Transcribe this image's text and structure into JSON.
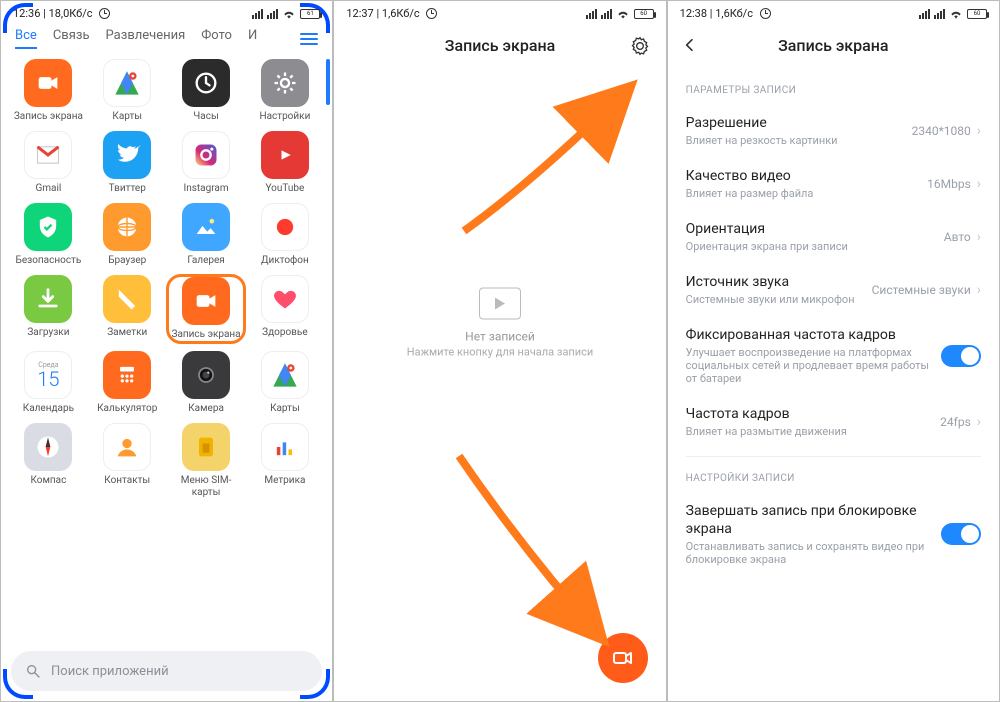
{
  "phone1": {
    "status": {
      "time": "12:36",
      "net": "18,0Кб/с",
      "battery": "61"
    },
    "tabs": [
      "Все",
      "Связь",
      "Развлечения",
      "Фото",
      "И"
    ],
    "apps": [
      {
        "label": "Запись экрана",
        "bg": "#ff6a1f",
        "glyph": "cam"
      },
      {
        "label": "Карты",
        "bg": "#ffffff",
        "glyph": "gmaps"
      },
      {
        "label": "Часы",
        "bg": "#2b2b2b",
        "glyph": "clock"
      },
      {
        "label": "Настройки",
        "bg": "#8c8c91",
        "glyph": "gear"
      },
      {
        "label": "Gmail",
        "bg": "#ffffff",
        "glyph": "gmail"
      },
      {
        "label": "Твиттер",
        "bg": "#1da1f2",
        "glyph": "twitter"
      },
      {
        "label": "Instagram",
        "bg": "#ffffff",
        "glyph": "instagram"
      },
      {
        "label": "YouTube",
        "bg": "#e53935",
        "glyph": "youtube"
      },
      {
        "label": "Безопасность",
        "bg": "#0ed57a",
        "glyph": "shield"
      },
      {
        "label": "Браузер",
        "bg": "#ff9a2e",
        "glyph": "globe"
      },
      {
        "label": "Галерея",
        "bg": "#3fa7ff",
        "glyph": "gallery"
      },
      {
        "label": "Диктофон",
        "bg": "#ffffff",
        "glyph": "rec"
      },
      {
        "label": "Загрузки",
        "bg": "#7ac943",
        "glyph": "download"
      },
      {
        "label": "Заметки",
        "bg": "#ffbf3b",
        "glyph": "notes"
      },
      {
        "label": "Запись экрана",
        "bg": "#ff6a1f",
        "glyph": "cam",
        "highlight": true
      },
      {
        "label": "Здоровье",
        "bg": "#ffffff",
        "glyph": "heart"
      },
      {
        "label": "Календарь",
        "bg": "#ffffff",
        "glyph": "calendar",
        "badge": "15",
        "sub": "Среда"
      },
      {
        "label": "Калькулятор",
        "bg": "#ff6a1f",
        "glyph": "calc"
      },
      {
        "label": "Камера",
        "bg": "#3a3a3d",
        "glyph": "camera"
      },
      {
        "label": "Карты",
        "bg": "#ffffff",
        "glyph": "gmaps"
      },
      {
        "label": "Компас",
        "bg": "#d9dde3",
        "glyph": "compass"
      },
      {
        "label": "Контакты",
        "bg": "#ffffff",
        "glyph": "contacts"
      },
      {
        "label": "Меню SIM-карты",
        "bg": "#f5d36b",
        "glyph": "sim"
      },
      {
        "label": "Метрика",
        "bg": "#ffffff",
        "glyph": "bars"
      }
    ],
    "search_placeholder": "Поиск приложений"
  },
  "phone2": {
    "status": {
      "time": "12:37",
      "net": "1,6Кб/с",
      "battery": "60"
    },
    "title": "Запись экрана",
    "empty_title": "Нет записей",
    "empty_sub": "Нажмите кнопку для начала записи"
  },
  "phone3": {
    "status": {
      "time": "12:38",
      "net": "1,6Кб/с",
      "battery": "60"
    },
    "title": "Запись экрана",
    "section1_title": "ПАРАМЕТРЫ ЗАПИСИ",
    "rows": [
      {
        "main": "Разрешение",
        "sub": "Влияет на резкость картинки",
        "val": "2340*1080",
        "kind": "chev"
      },
      {
        "main": "Качество видео",
        "sub": "Влияет на размер файла",
        "val": "16Mbps",
        "kind": "chev"
      },
      {
        "main": "Ориентация",
        "sub": "Ориентация экрана при записи",
        "val": "Авто",
        "kind": "chev"
      },
      {
        "main": "Источник звука",
        "sub": "Системные звуки или микрофон",
        "val": "Системные звуки",
        "kind": "chev"
      },
      {
        "main": "Фиксированная частота кадров",
        "sub": "Улучшает воспроизведение на платформах социальных сетей и продлевает время работы от батареи",
        "val": "",
        "kind": "toggle"
      },
      {
        "main": "Частота кадров",
        "sub": "Влияет на размытие движения",
        "val": "24fps",
        "kind": "chev"
      }
    ],
    "section2_title": "НАСТРОЙКИ ЗАПИСИ",
    "rows2": [
      {
        "main": "Завершать запись при блокировке экрана",
        "sub": "Останавливать запись и сохранять видео при блокировке экрана",
        "val": "",
        "kind": "toggle"
      }
    ]
  }
}
